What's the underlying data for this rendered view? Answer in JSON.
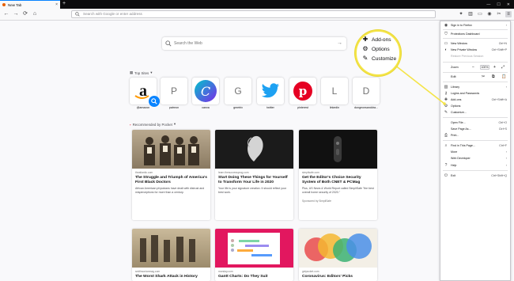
{
  "tab": {
    "title": "New Tab",
    "close": "×",
    "new": "+"
  },
  "window": {
    "min": "—",
    "max": "☐",
    "close": "✕"
  },
  "nav": {
    "back": "←",
    "forward": "→",
    "reload": "⟳",
    "home": "⌂"
  },
  "urlbar": {
    "placeholder": "Search with Google or enter address"
  },
  "search": {
    "placeholder": "Search the Web",
    "go": "→"
  },
  "topsites": {
    "heading": "Top Sites",
    "chevron": "▾",
    "items": [
      {
        "letter": "",
        "label": "@amazon"
      },
      {
        "letter": "P",
        "label": "patreon"
      },
      {
        "letter": "C",
        "label": "canva"
      },
      {
        "letter": "G",
        "label": "gmetrix"
      },
      {
        "letter": "",
        "label": "twitter"
      },
      {
        "letter": "",
        "label": "pinterest"
      },
      {
        "letter": "L",
        "label": "linkedin"
      },
      {
        "letter": "D",
        "label": "dungeonsanddra..."
      }
    ]
  },
  "pocket": {
    "heading": "Recommended by Pocket",
    "cards": [
      {
        "source": "theatlantic.com",
        "title": "The Struggle and Triumph of America's First Black Doctors",
        "desc": "African American physicians have dealt with distrust and misperceptions for more than a century.",
        "sponsored": ""
      },
      {
        "source": "learn.thesuccessprog.com",
        "title": "Start Doing These Things for Yourself to Transform Your Life in 2020",
        "desc": "Your life is your signature creation. It should reflect your best work.",
        "sponsored": ""
      },
      {
        "source": "simplisafe.com",
        "title": "Get the Editor's Choice Security System of Both CNET & PCMag",
        "desc": "Plus, US News & World Report called SimpliSafe \"the best overall home security of 2020.\"",
        "sponsored": "Sponsored by SimpliSafe"
      },
      {
        "source": "smithsonianmag.com",
        "title": "The Worst Shark Attack in History",
        "desc": "",
        "sponsored": ""
      },
      {
        "source": "monday.com",
        "title": "Gantt Charts: Do They Suit",
        "desc": "",
        "sponsored": ""
      },
      {
        "source": "getpocket.com",
        "title": "Coronavirus: Editors' Picks",
        "desc": "",
        "sponsored": ""
      }
    ]
  },
  "menu": {
    "sign_in": "Sign in to Firefox",
    "protections": "Protections Dashboard",
    "new_window": "New Window",
    "new_window_sc": "Ctrl+N",
    "new_private": "New Private Window",
    "new_private_sc": "Ctrl+Shift+P",
    "restore": "Restore Previous Session",
    "zoom": "Zoom",
    "zoom_value": "100%",
    "edit": "Edit",
    "library": "Library",
    "logins": "Logins and Passwords",
    "addons": "Add-ons",
    "addons_sc": "Ctrl+Shift+A",
    "options": "Options",
    "customize": "Customize...",
    "open_file": "Open File...",
    "open_file_sc": "Ctrl+O",
    "save_page": "Save Page As...",
    "save_page_sc": "Ctrl+S",
    "print": "Print...",
    "find": "Find in This Page...",
    "find_sc": "Ctrl+F",
    "more": "More",
    "web_dev": "Web Developer",
    "help": "Help",
    "exit": "Exit",
    "exit_sc": "Ctrl+Shift+Q",
    "arrow": "›"
  },
  "callout": {
    "addons": "Add-ons",
    "options": "Options",
    "customize": "Customize"
  },
  "colors": {
    "accent": "#0a84ff",
    "callout_yellow": "#f4e447",
    "twitter": "#1da1f2",
    "pinterest": "#e60023",
    "canva": "#7d2ae8"
  }
}
